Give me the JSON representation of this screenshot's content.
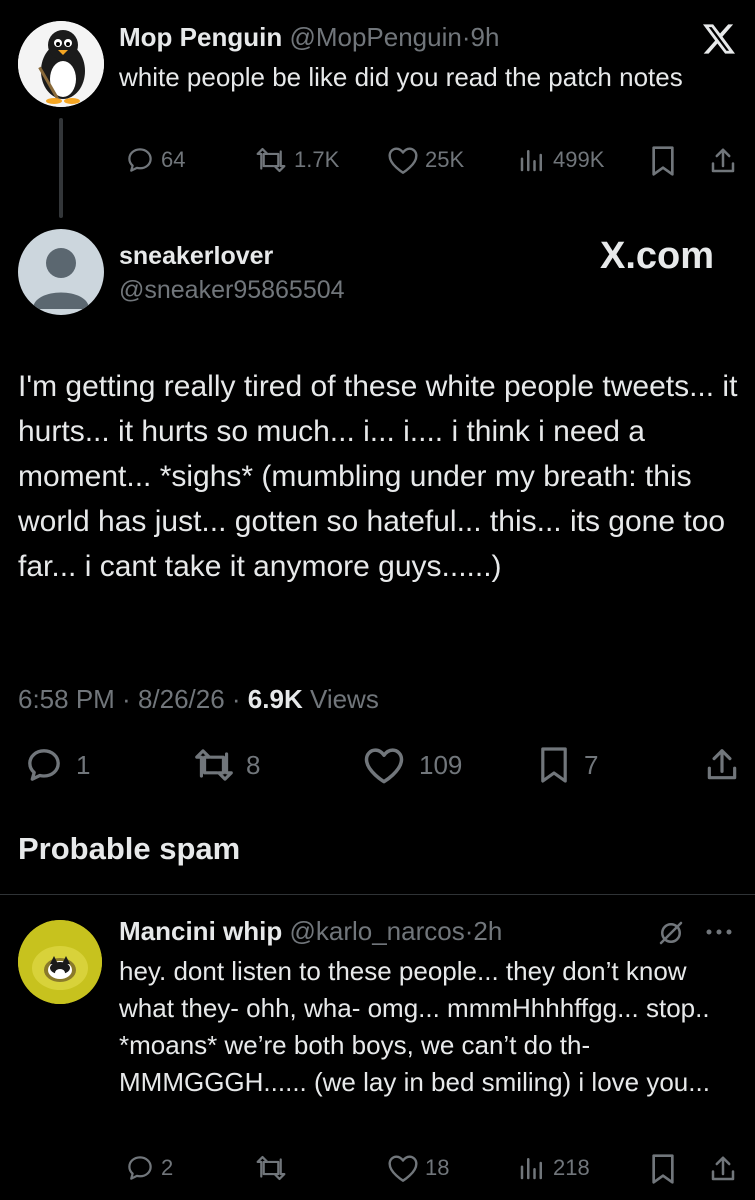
{
  "tweet1": {
    "name": "Mop Penguin",
    "handle": "@MopPenguin",
    "dot": "·",
    "time": "9h",
    "text": "white people be like did you read the patch notes",
    "replies": "64",
    "retweets": "1.7K",
    "likes": "25K",
    "views": "499K"
  },
  "main": {
    "name": "sneakerlover",
    "handle": "@sneaker95865504",
    "brand": "X.com",
    "text": "I'm getting really tired of these white people tweets... it hurts... it hurts so much... i... i.... i think i need a moment... *sighs* (mumbling under my breath: this world has just... gotten so hateful... this... its gone too far... i cant take it anymore guys......)",
    "time": "6:58 PM",
    "date": "8/26/26",
    "views_count": "6.9K",
    "views_label": "Views",
    "replies": "1",
    "retweets": "8",
    "likes": "109",
    "bookmarks": "7"
  },
  "section_header": "Probable spam",
  "reply": {
    "name": "Mancini whip",
    "handle": "@karlo_narcos",
    "time": "2h",
    "text": "hey. dont listen to these people... they don’t know what they- ohh, wha- omg... mmmHhhhffgg... stop.. *moans* we’re both boys, we can’t do th- MMMGGGH...... (we lay in bed smiling) i love you...",
    "replies": "2",
    "likes": "18",
    "views": "218"
  },
  "colors": {
    "background": "#000000",
    "text": "#e7e9ea",
    "muted": "#71767b",
    "divider": "#2f3336"
  }
}
